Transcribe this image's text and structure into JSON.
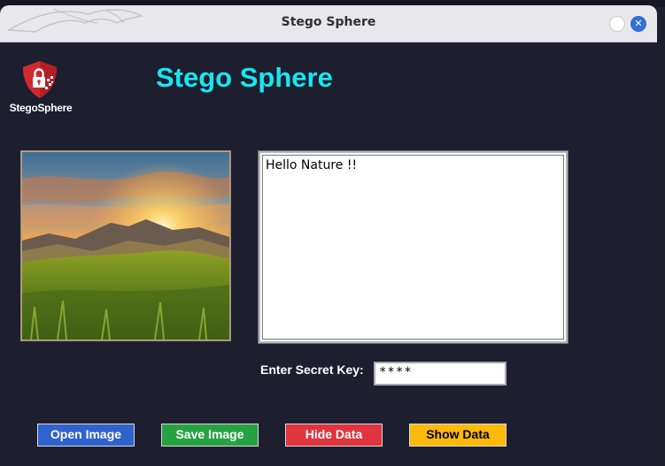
{
  "window": {
    "title": "Stego Sphere",
    "close_symbol": "✕"
  },
  "header": {
    "logo_text": "StegoSphere",
    "app_title": "Stego Sphere"
  },
  "message": {
    "text": "Hello Nature !!"
  },
  "secret_key": {
    "label": "Enter Secret Key:",
    "value": "****"
  },
  "buttons": {
    "open": "Open Image",
    "save": "Save Image",
    "hide": "Hide Data",
    "show": "Show Data"
  },
  "colors": {
    "background": "#1e1f2e",
    "title_accent": "#19e5f2",
    "open_button": "#2f62cd",
    "save_button": "#27a243",
    "hide_button": "#e0343e",
    "show_button": "#fbb909"
  },
  "icons": {
    "logo": "shield-lock-icon",
    "minimize": "circle-button-icon",
    "close": "close-icon"
  }
}
